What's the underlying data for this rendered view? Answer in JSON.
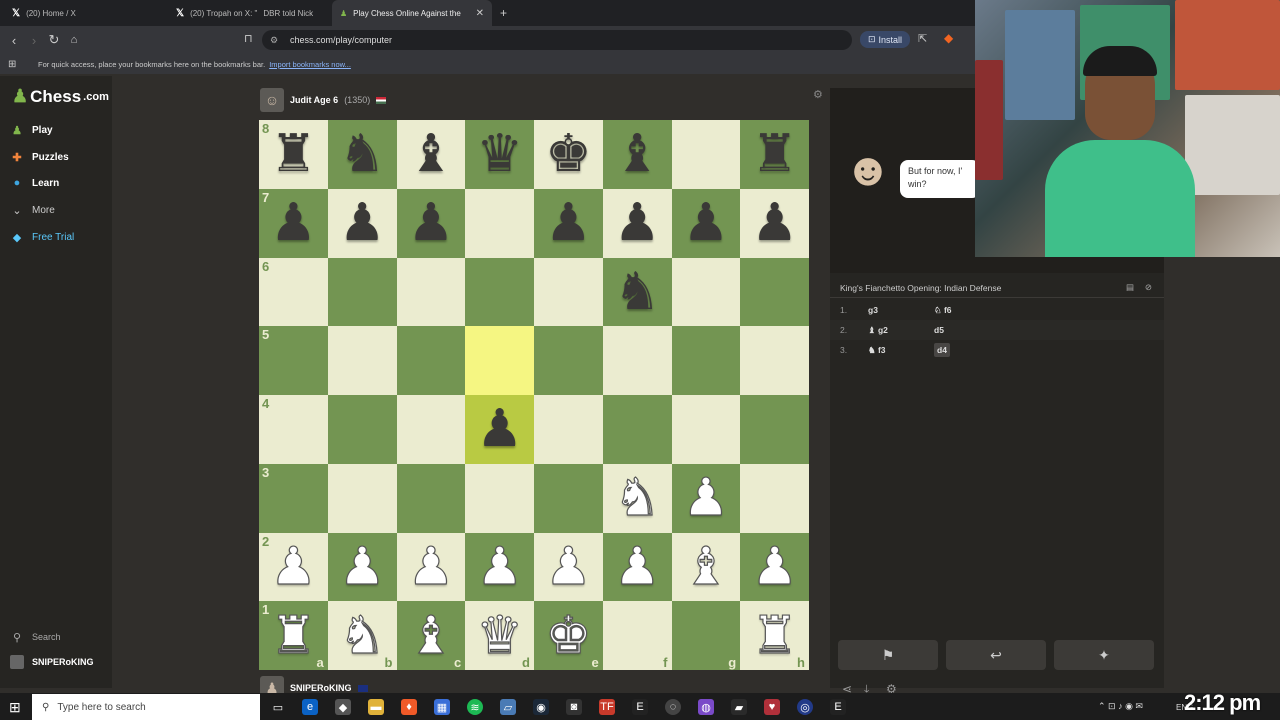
{
  "browser": {
    "tabs": [
      {
        "label": "(20) Home / X"
      },
      {
        "label": "(20) Tropah on X: \"",
        "suffix": "DBR told Nick"
      },
      {
        "label": "Play Chess Online Against the"
      }
    ],
    "url": "chess.com/play/computer",
    "install_label": "Install",
    "bookmarks_text": "For quick access, place your bookmarks here on the bookmarks bar.",
    "bookmarks_link": "Import bookmarks now..."
  },
  "sidebar": {
    "logo_text": "Chess",
    "logo_suffix": ".com",
    "items": [
      {
        "label": "Play",
        "icon": "play-icon"
      },
      {
        "label": "Puzzles",
        "icon": "puzzle-icon"
      },
      {
        "label": "Learn",
        "icon": "learn-icon"
      },
      {
        "label": "More",
        "icon": "chevron-down-icon"
      },
      {
        "label": "Free Trial",
        "icon": "diamond-icon"
      }
    ],
    "search_label": "Search",
    "username": "SNIPERoKING"
  },
  "game": {
    "top_player": {
      "name": "Judit Age 6",
      "rating": "(1350)"
    },
    "bottom_player": {
      "name": "SNIPERoKING"
    },
    "bot_message": "But for now, I'll win?",
    "bot_message_line1": "But for now, I'",
    "bot_message_line2": "win?",
    "opening": "King's Fianchetto Opening: Indian Defense",
    "moves": [
      {
        "num": "1.",
        "white": "g3",
        "black": "f6",
        "black_piece": "♘"
      },
      {
        "num": "2.",
        "white": "g2",
        "white_piece": "♝",
        "black": "d5"
      },
      {
        "num": "3.",
        "white": "f3",
        "white_piece": "♞",
        "black": "d4"
      }
    ],
    "ranks": [
      "8",
      "7",
      "6",
      "5",
      "4",
      "3",
      "2",
      "1"
    ],
    "files": [
      "a",
      "b",
      "c",
      "d",
      "e",
      "f",
      "g",
      "h"
    ],
    "board": [
      [
        "br",
        "bn",
        "bb",
        "bq",
        "bk",
        "bb",
        "",
        ""
      ],
      [
        "bp",
        "bp",
        "bp",
        "",
        "bp",
        "bp",
        "bp",
        "bp"
      ],
      [
        "",
        "",
        "",
        "",
        "",
        "bn",
        "",
        ""
      ],
      [
        "",
        "",
        "",
        "",
        "",
        "",
        "",
        ""
      ],
      [
        "",
        "",
        "",
        "bp",
        "",
        "",
        "",
        ""
      ],
      [
        "",
        "",
        "",
        "",
        "",
        "wn",
        "wp",
        ""
      ],
      [
        "wp",
        "wp",
        "wp",
        "wp",
        "wp",
        "wp",
        "wb",
        "wp"
      ],
      [
        "wr",
        "wn",
        "wb",
        "wq",
        "wk",
        "",
        "",
        "wr"
      ]
    ],
    "board_extra": {
      "h8": "br"
    },
    "highlight": [
      "d5",
      "d4"
    ]
  },
  "taskbar": {
    "search_placeholder": "Type here to search",
    "clock": "2:12 pm",
    "lang": "ENG"
  },
  "colors": {
    "light_square": "#ebecd0",
    "dark_square": "#739552",
    "highlight_light": "#f5f682",
    "highlight_dark": "#b9ca43"
  }
}
